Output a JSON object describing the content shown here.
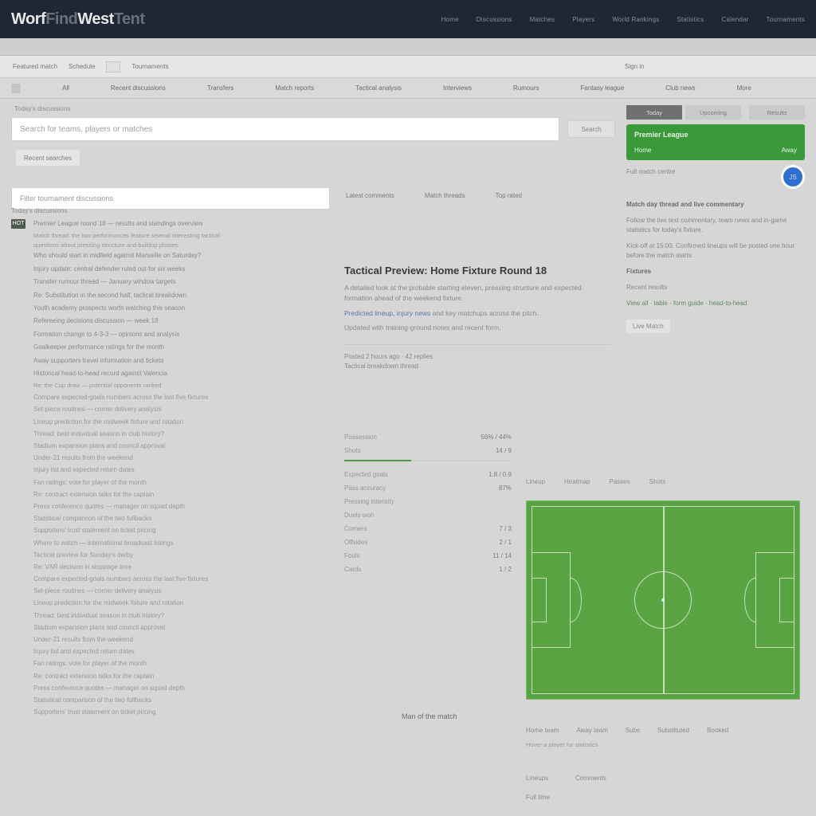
{
  "header": {
    "logo_a": "Worf",
    "logo_b": "Find",
    "logo_c": "West",
    "logo_d": "Tent",
    "nav": [
      "Home",
      "Discussions",
      "Matches",
      "Players",
      "World  Rankings",
      "Statistics",
      "Calendar",
      "Tournaments"
    ]
  },
  "bar3": {
    "left_a": "Featured match",
    "left_b": "Schedule",
    "left_c": "Tournaments",
    "right": "Sign  in"
  },
  "tabs": [
    "All",
    "Recent  discussions",
    "Transfers",
    "Match  reports",
    "Tactical  analysis",
    "Interviews",
    "Rumours",
    "Fantasy  league",
    "Club  news",
    "More"
  ],
  "search": {
    "placeholder": "Search  for  teams,  players  or  matches",
    "button": "Search",
    "chip": "Recent  searches"
  },
  "search2": {
    "placeholder": "Filter  tournament  discussions"
  },
  "linksrow": [
    "Latest  comments",
    "Match  threads",
    "Top  rated"
  ],
  "feed": {
    "header": "Today's  discussions",
    "items": [
      "Premier  League  round  18  —  results  and  standings  overview",
      "Who  should  start  in  midfield  against  Marseille  on  Saturday?",
      "Injury  update:  central  defender  ruled  out  for  six  weeks",
      "Transfer  rumour  thread  —  January  window  targets",
      "Re:  Substitution  in  the  second  half,  tactical  breakdown",
      "Youth  academy  prospects  worth  watching  this  season",
      "Refereeing  decisions  discussion  —  week  18",
      "Formation  change  to  4-3-3  —  opinions  and  analysis",
      "Goalkeeper  performance  ratings  for  the  month",
      "Away  supporters  travel  information  and  tickets",
      "Historical  head-to-head  record  against  Valencia"
    ]
  },
  "sidefeed": [
    "Match  thread:  the  two  performances  feature  several  interesting  tactical",
    "questions  about  pressing  structure  and  buildup  phases",
    "Re:  the  Cup  draw  —  potential  opponents  ranked",
    "Compare  expected-goals  numbers  across  the  last  five  fixtures",
    "Set-piece  routines  —  corner  delivery  analysis",
    "Lineup  prediction  for  the  midweek  fixture  and  rotation",
    "Thread:  best  individual  season  in  club  history?",
    "Stadium  expansion  plans  and  council  approval",
    "Under-21  results  from  the  weekend",
    "Injury  list  and  expected  return  dates",
    "Fan  ratings:  vote  for  player  of  the  month",
    "Re:  contract  extension  talks  for  the  captain",
    "Press  conference  quotes  —  manager  on  squad  depth",
    "Statistical  comparison  of  the  two  fullbacks",
    "Supporters'  trust  statement  on  ticket  pricing",
    "Where  to  watch  —  international  broadcast  listings",
    "Tactical  preview  for  Sunday's  derby",
    "Re:  VAR  decision  in  stoppage  time"
  ],
  "article": {
    "title": "Tactical  Preview:  Home  Fixture  Round  18",
    "p1": "A  detailed  look  at  the  probable  starting  eleven,  pressing  structure  and  expected  formation  ahead  of  the  weekend  fixture.",
    "p2a": "Predicted  lineup,",
    "p2b": "injury  news",
    "p2c": "  and  key  matchups  across  the  pitch.",
    "p3": "Updated  with  training-ground  notes  and  recent  form.",
    "meta1": "Posted  2  hours  ago  ·  42  replies",
    "meta2": "Tactical  breakdown  thread"
  },
  "table": {
    "rows": [
      [
        "Possession",
        "56%  /  44%"
      ],
      [
        "Shots",
        "14   /   9"
      ],
      [
        "Expected  goals",
        "1.8   /   0.9"
      ],
      [
        "Pass  accuracy",
        "87%"
      ],
      [
        "Pressing  intensity",
        ""
      ],
      [
        "Duels  won",
        ""
      ],
      [
        "Corners",
        "7   /   3"
      ],
      [
        "Offsides",
        "2   /   1"
      ],
      [
        "Fouls",
        "11  /  14"
      ],
      [
        "Cards",
        "1   /   2"
      ]
    ]
  },
  "right": {
    "pills": [
      "Today",
      "Upcoming",
      "Results"
    ],
    "match_title": "Premier  League",
    "home": "Home",
    "away": "Away",
    "link1": "Full  match  centre",
    "link2": "",
    "avatar": "JS",
    "headline": "Match  day  thread  and  live  commentary",
    "para1": "Follow  the  live  text  commentary,  team  news  and  in-game  statistics  for  today's  fixture.",
    "para2": "Kick-off  at  15:00.  Confirmed  lineups  will  be  posted  one  hour  before  the  match  starts.",
    "section": "Fixtures",
    "sub": "Recent  results",
    "line": "View  all  ·  table  ·  form  guide  ·  head-to-head",
    "tab": "Live  Match"
  },
  "pitchtabs": [
    "Lineup",
    "Heatmap",
    "Passes",
    "Shots"
  ],
  "legend": [
    "Home  team",
    "Away  team",
    "Subs",
    "Substituted",
    "Booked"
  ],
  "legend2": "Hover  a  player  for  statistics",
  "subhead": "Man  of  the  match",
  "minirow": [
    "Lineups",
    "Comments"
  ],
  "mini2": "Full  time"
}
